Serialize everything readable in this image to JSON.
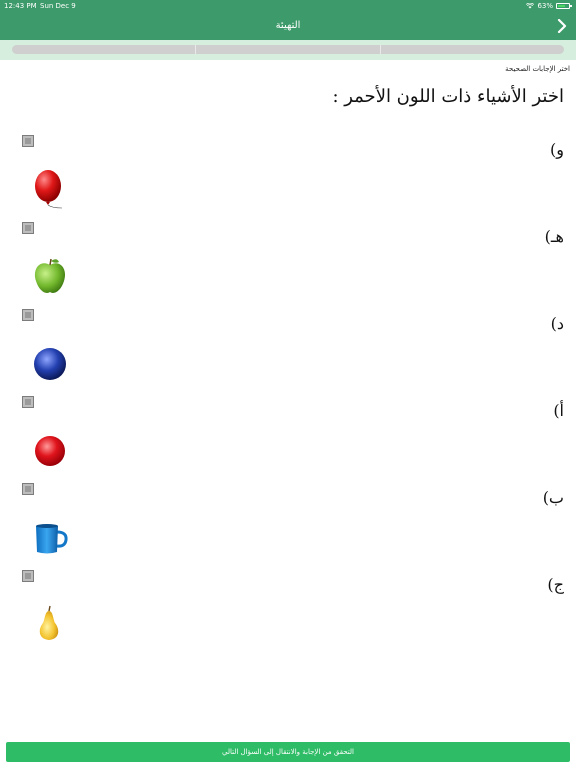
{
  "status_bar": {
    "time": "12:43 PM",
    "date": "Sun Dec 9",
    "battery": "63%"
  },
  "nav": {
    "title": "التهيئة",
    "back_icon": "chevron-right-icon"
  },
  "progress": {
    "segments": 3,
    "completed": 0
  },
  "instruction": "اختر الإجابات الصحيحة",
  "question": "اختر الأشياء ذات اللون الأحمر :",
  "options": [
    {
      "label": "و)",
      "image": "red-balloon",
      "checked": false
    },
    {
      "label": "هـ)",
      "image": "green-apple",
      "checked": false
    },
    {
      "label": "د)",
      "image": "blue-ball",
      "checked": false
    },
    {
      "label": "أ)",
      "image": "red-ball",
      "checked": false
    },
    {
      "label": "ب)",
      "image": "blue-mug",
      "checked": false
    },
    {
      "label": "ج)",
      "image": "yellow-pear",
      "checked": false
    }
  ],
  "submit_label": "التحقق من الإجابة والانتقال إلى السؤال التالي",
  "colors": {
    "accent": "#3d9a6a",
    "button": "#2fbc66"
  }
}
